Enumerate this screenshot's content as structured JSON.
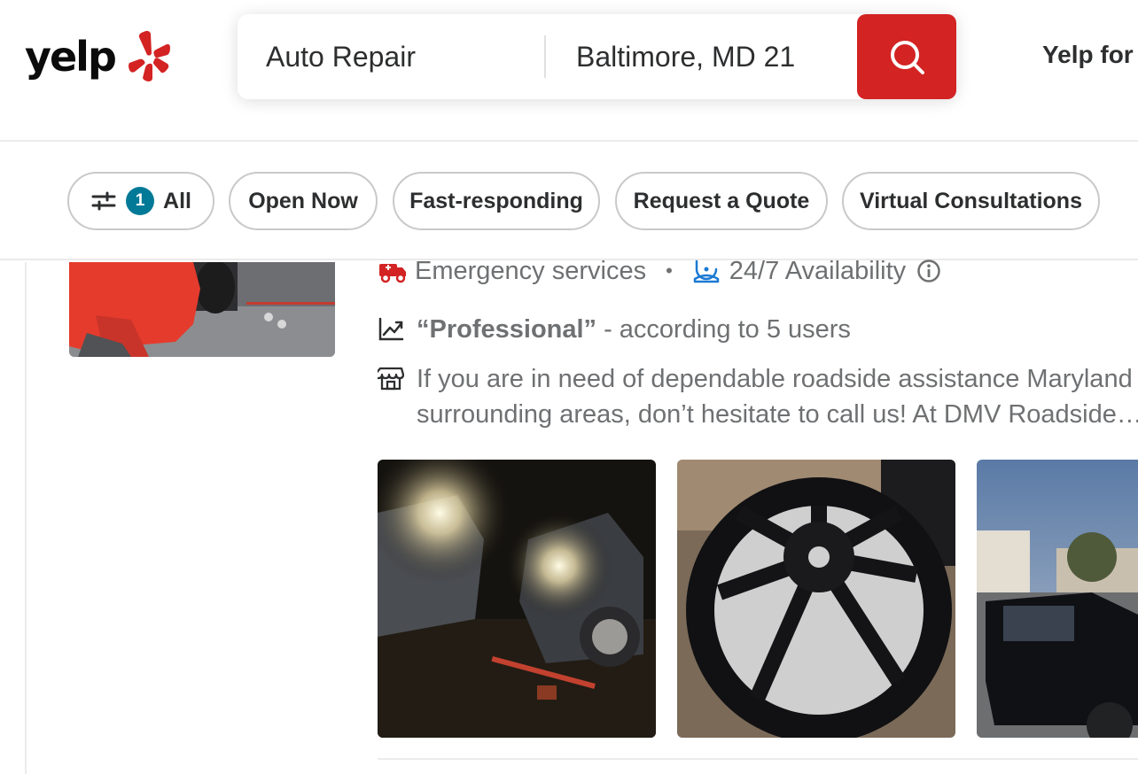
{
  "header": {
    "logo_text": "yelp",
    "logo_icon": "yelp-burst-icon",
    "search": {
      "find_value": "Auto Repair",
      "near_value": "Baltimore, MD 21",
      "button_icon": "search-icon"
    },
    "yelp_for_business": "Yelp for"
  },
  "filters": {
    "all": {
      "icon": "sliders-icon",
      "count": "1",
      "label": "All"
    },
    "pills": [
      "Open Now",
      "Fast-responding",
      "Request a Quote",
      "Virtual Consultations"
    ]
  },
  "business": {
    "amenities": [
      {
        "icon": "emergency-truck-icon",
        "label": "Emergency services"
      },
      {
        "icon": "clock-247-icon",
        "label": "24/7 Availability"
      }
    ],
    "separator": "•",
    "info_icon": "info-icon",
    "highlight": {
      "icon": "trend-icon",
      "quote": "“Professional”",
      "rest": "- according to 5 users"
    },
    "snippet": {
      "icon": "storefront-icon",
      "text": "If you are in need of dependable roadside assistance Maryland surrounding areas, don’t hesitate to call us! At DMV Roadside…"
    }
  },
  "colors": {
    "brand_red": "#d32323",
    "badge_teal": "#027a97",
    "availability_blue": "#1b7ad3",
    "text_dark": "#2d2e2f",
    "text_muted": "#6e7072"
  }
}
